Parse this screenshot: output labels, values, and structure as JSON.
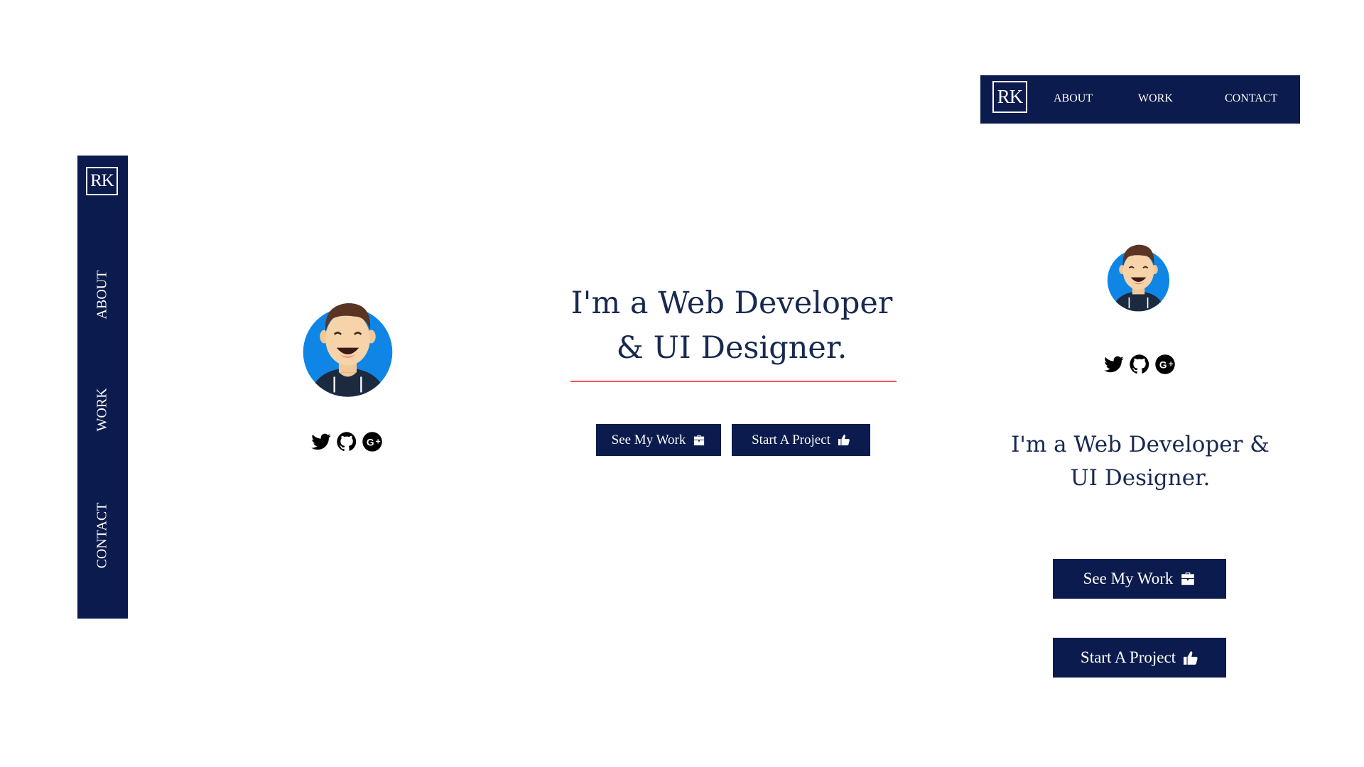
{
  "brand": {
    "logo_text": "RK"
  },
  "nav": {
    "about": "ABOUT",
    "work": "WORK",
    "contact": "CONTACT"
  },
  "hero": {
    "desktop_line1": "I'm a Web Developer",
    "desktop_line2": "& UI Designer.",
    "mobile_line1": "I'm a Web Developer &",
    "mobile_line2": "UI Designer."
  },
  "buttons": {
    "see_work": "See My Work",
    "see_work_icon": "briefcase-icon",
    "start_project": "Start A Project",
    "start_project_icon": "thumbs-up-icon"
  },
  "social": [
    "twitter-icon",
    "github-icon",
    "google-plus-icon"
  ],
  "colors": {
    "navy": "#0c1b4d",
    "heading": "#17294f",
    "accent_underline": "#f2555a",
    "avatar_bg": "#0f86e5"
  }
}
